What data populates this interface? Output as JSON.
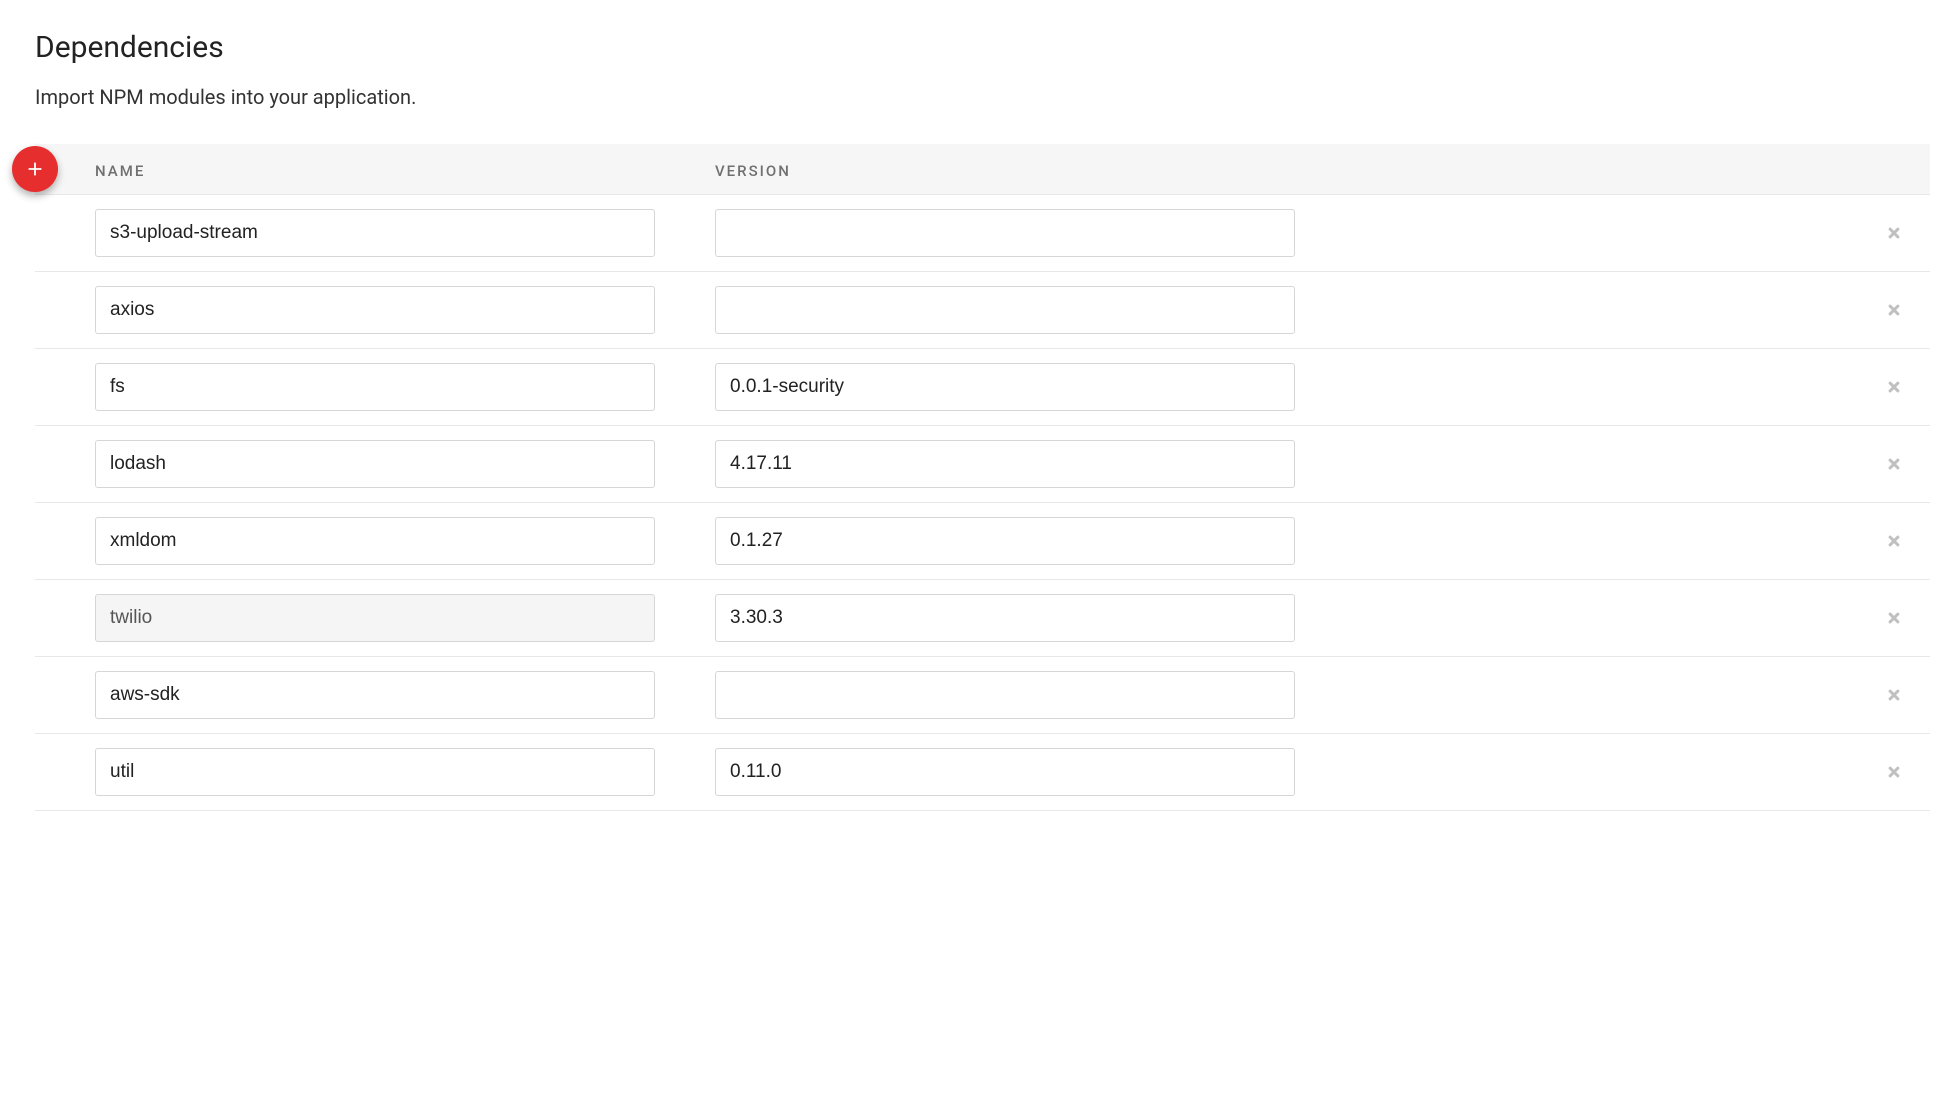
{
  "header": {
    "title": "Dependencies",
    "description": "Import NPM modules into your application."
  },
  "table": {
    "columns": {
      "name": "NAME",
      "version": "VERSION"
    },
    "rows": [
      {
        "name": "s3-upload-stream",
        "version": "",
        "disabled": false
      },
      {
        "name": "axios",
        "version": "",
        "disabled": false
      },
      {
        "name": "fs",
        "version": "0.0.1-security",
        "disabled": false
      },
      {
        "name": "lodash",
        "version": "4.17.11",
        "disabled": false
      },
      {
        "name": "xmldom",
        "version": "0.1.27",
        "disabled": false
      },
      {
        "name": "twilio",
        "version": "3.30.3",
        "disabled": true
      },
      {
        "name": "aws-sdk",
        "version": "",
        "disabled": false
      },
      {
        "name": "util",
        "version": "0.11.0",
        "disabled": false
      }
    ]
  }
}
